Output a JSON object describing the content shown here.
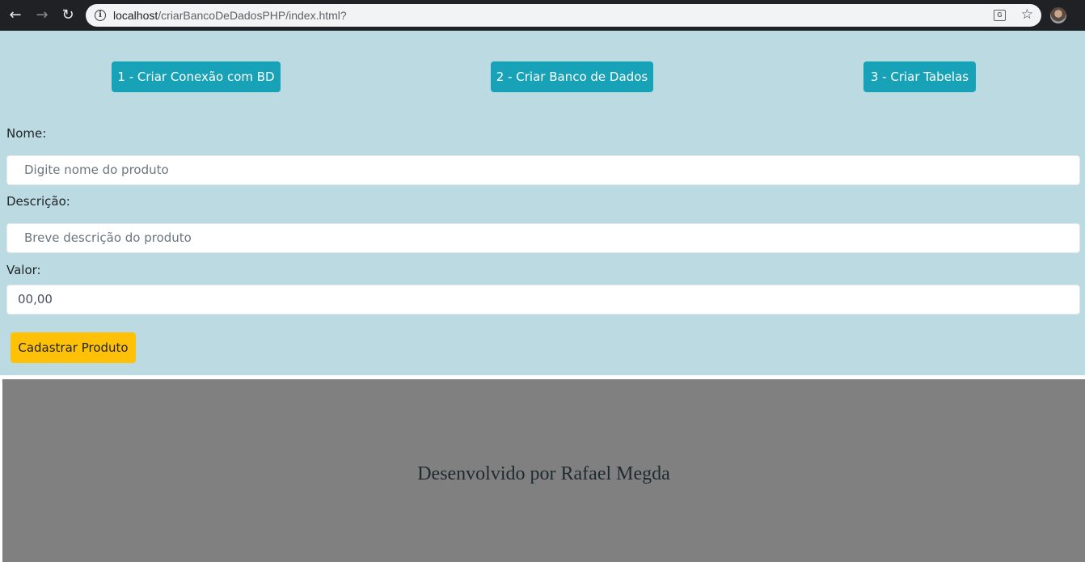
{
  "browser": {
    "url_host": "localhost",
    "url_path": "/criarBancoDeDadosPHP/index.html?",
    "back_icon": "←",
    "forward_icon": "→",
    "reload_icon": "↻",
    "info_icon": "i",
    "translate_icon": "G",
    "star_icon": "☆"
  },
  "actions": {
    "btn1_label": "1 - Criar Conexão com BD",
    "btn2_label": "2 - Criar Banco de Dados",
    "btn3_label": "3 - Criar Tabelas"
  },
  "form": {
    "nome_label": "Nome:",
    "nome_placeholder": "Digite nome do produto",
    "descricao_label": "Descrição:",
    "descricao_placeholder": "Breve descrição do produto",
    "valor_label": "Valor:",
    "valor_value": "00,00",
    "submit_label": "Cadastrar Produto"
  },
  "footer": {
    "text": "Desenvolvido por Rafael Megda"
  },
  "colors": {
    "page_bg": "#bcdae1",
    "info_button": "#17a2b8",
    "warning_button": "#ffc107",
    "footer_bg": "#808080"
  }
}
